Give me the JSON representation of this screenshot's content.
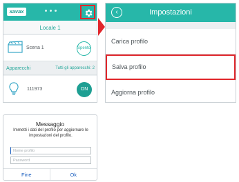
{
  "main_screen": {
    "logo": "xavax",
    "section_title": "Locale 1",
    "scene": {
      "label": "Scena 1",
      "button": "Spento",
      "icon": "scene-icon"
    },
    "devices_header": {
      "title": "Apparecchi",
      "all_link": "Tutti gli apparecchi: 2"
    },
    "device": {
      "id": "111973",
      "button": "ON",
      "icon": "bulb-icon"
    },
    "settings_icon": "gear-icon"
  },
  "settings_screen": {
    "title": "Impostazioni",
    "back_icon": "back-icon",
    "items": [
      {
        "label": "Carica profilo"
      },
      {
        "label": "Salva profilo",
        "highlighted": true
      },
      {
        "label": "Aggiorna profilo"
      }
    ]
  },
  "dialog": {
    "title": "Messaggio",
    "message": "Immetti i dati del profilo per aggiornare le impostazioni del profilo.",
    "name_placeholder": "Nome profilo",
    "password_placeholder": "Password",
    "cancel_label": "Fine",
    "ok_label": "Ok"
  },
  "colors": {
    "accent": "#27b7a9",
    "highlight": "#e1262b",
    "dialog_button": "#1b5fbf"
  }
}
